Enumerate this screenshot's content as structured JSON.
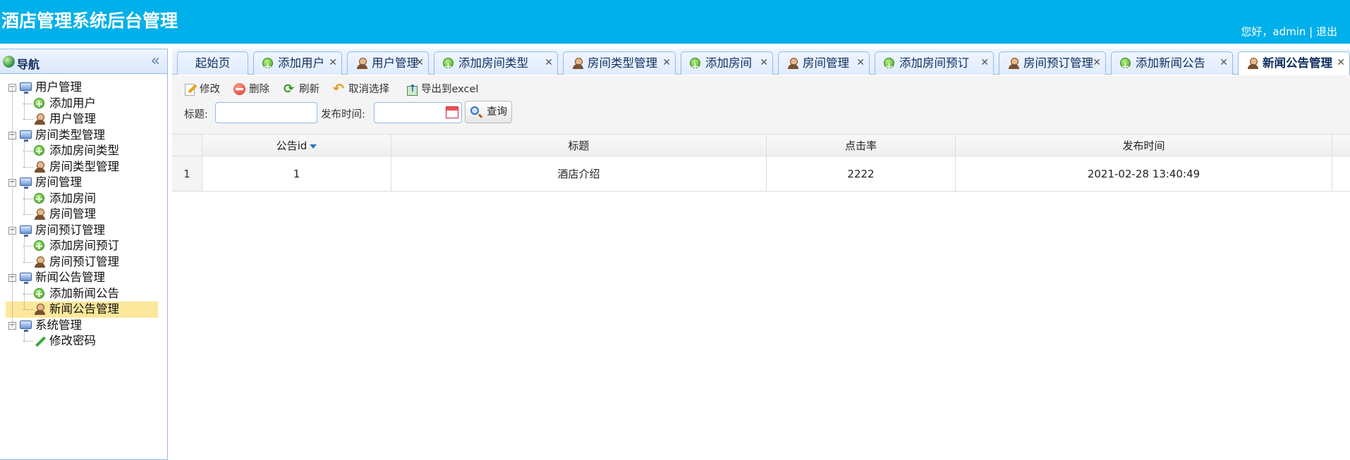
{
  "header": {
    "title": "酒店管理系统后台管理",
    "greeting": "您好，admin",
    "separator": " | ",
    "logout": "退出"
  },
  "sidebar": {
    "title": "导航",
    "collapse_icon": "double-chevron-left-icon",
    "groups": [
      {
        "label": "用户管理",
        "items": [
          "添加用户",
          "用户管理"
        ]
      },
      {
        "label": "房间类型管理",
        "items": [
          "添加房间类型",
          "房间类型管理"
        ]
      },
      {
        "label": "房间管理",
        "items": [
          "添加房间",
          "房间管理"
        ]
      },
      {
        "label": "房间预订管理",
        "items": [
          "添加房间预订",
          "房间预订管理"
        ]
      },
      {
        "label": "新闻公告管理",
        "items": [
          "添加新闻公告",
          "新闻公告管理"
        ]
      },
      {
        "label": "系统管理",
        "items": [
          "修改密码"
        ]
      }
    ],
    "selected_item": "新闻公告管理"
  },
  "tabs": [
    {
      "label": "起始页",
      "icon": "",
      "closable": false
    },
    {
      "label": "添加用户",
      "icon": "add-icon",
      "closable": true
    },
    {
      "label": "用户管理",
      "icon": "user-icon",
      "closable": true
    },
    {
      "label": "添加房间类型",
      "icon": "add-icon",
      "closable": true
    },
    {
      "label": "房间类型管理",
      "icon": "user-icon",
      "closable": true
    },
    {
      "label": "添加房间",
      "icon": "add-icon",
      "closable": true
    },
    {
      "label": "房间管理",
      "icon": "user-icon",
      "closable": true
    },
    {
      "label": "添加房间预订",
      "icon": "add-icon",
      "closable": true
    },
    {
      "label": "房间预订管理",
      "icon": "user-icon",
      "closable": true
    },
    {
      "label": "添加新闻公告",
      "icon": "add-icon",
      "closable": true
    },
    {
      "label": "新闻公告管理",
      "icon": "user-icon",
      "closable": true,
      "active": true
    }
  ],
  "toolbar": {
    "edit": "修改",
    "delete": "删除",
    "refresh": "刷新",
    "cancel_select": "取消选择",
    "export": "导出到excel"
  },
  "search": {
    "title_label": "标题:",
    "title_value": "",
    "date_label": "发布时间:",
    "date_value": "",
    "query_button": "查询"
  },
  "grid": {
    "columns": [
      "公告id",
      "标题",
      "点击率",
      "发布时间"
    ],
    "sorted_column": "公告id",
    "rows": [
      {
        "rownum": "1",
        "cells": [
          "1",
          "酒店介绍",
          "2222",
          "2021-02-28 13:40:49"
        ]
      }
    ]
  }
}
